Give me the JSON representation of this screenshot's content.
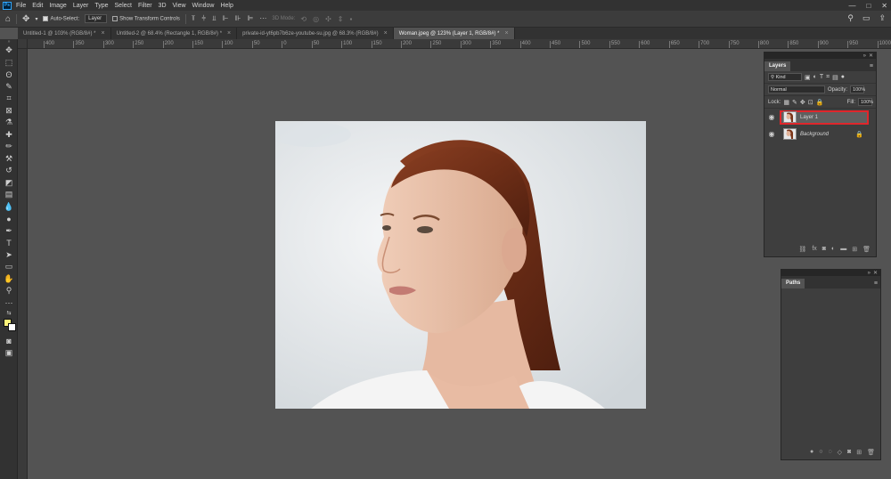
{
  "menubar": {
    "logo": "Ps",
    "items": [
      "File",
      "Edit",
      "Image",
      "Layer",
      "Type",
      "Select",
      "Filter",
      "3D",
      "View",
      "Window",
      "Help"
    ],
    "window_controls": [
      "—",
      "□",
      "✕"
    ]
  },
  "options": {
    "auto_select_label": "Auto-Select:",
    "auto_select_value": "Layer",
    "show_transform_label": "Show Transform Controls",
    "mode_3d_label": "3D Mode:"
  },
  "tabs": [
    {
      "label": "Untitled-1 @ 103% (RGB/8#) *"
    },
    {
      "label": "Untitled-2 @ 68.4% (Rectangle 1, RGB/8#) *"
    },
    {
      "label": "private-id-yt6pb7b6ze-youtube-su.jpg @ 68.3% (RGB/8#)"
    },
    {
      "label": "Woman.jpeg @ 123% (Layer 1, RGB/8#) *"
    }
  ],
  "ruler_ticks": [
    "400",
    "350",
    "300",
    "250",
    "200",
    "150",
    "100",
    "50",
    "0",
    "50",
    "100",
    "150",
    "200",
    "250",
    "300",
    "350",
    "400",
    "450",
    "500",
    "550",
    "600",
    "650",
    "700",
    "750",
    "800",
    "850",
    "900",
    "950",
    "1000"
  ],
  "layers_panel": {
    "tab": "Layers",
    "filter_label": "Kind",
    "blend_mode": "Normal",
    "opacity_label": "Opacity:",
    "opacity_value": "100%",
    "lock_label": "Lock:",
    "fill_label": "Fill:",
    "fill_value": "100%",
    "layers": [
      {
        "name": "Layer 1",
        "selected": true
      },
      {
        "name": "Background",
        "selected": false
      }
    ]
  },
  "paths_panel": {
    "tab": "Paths"
  },
  "colors": {
    "foreground": "#fff37a",
    "background": "#ffffff",
    "selection_highlight": "#e0262b"
  }
}
